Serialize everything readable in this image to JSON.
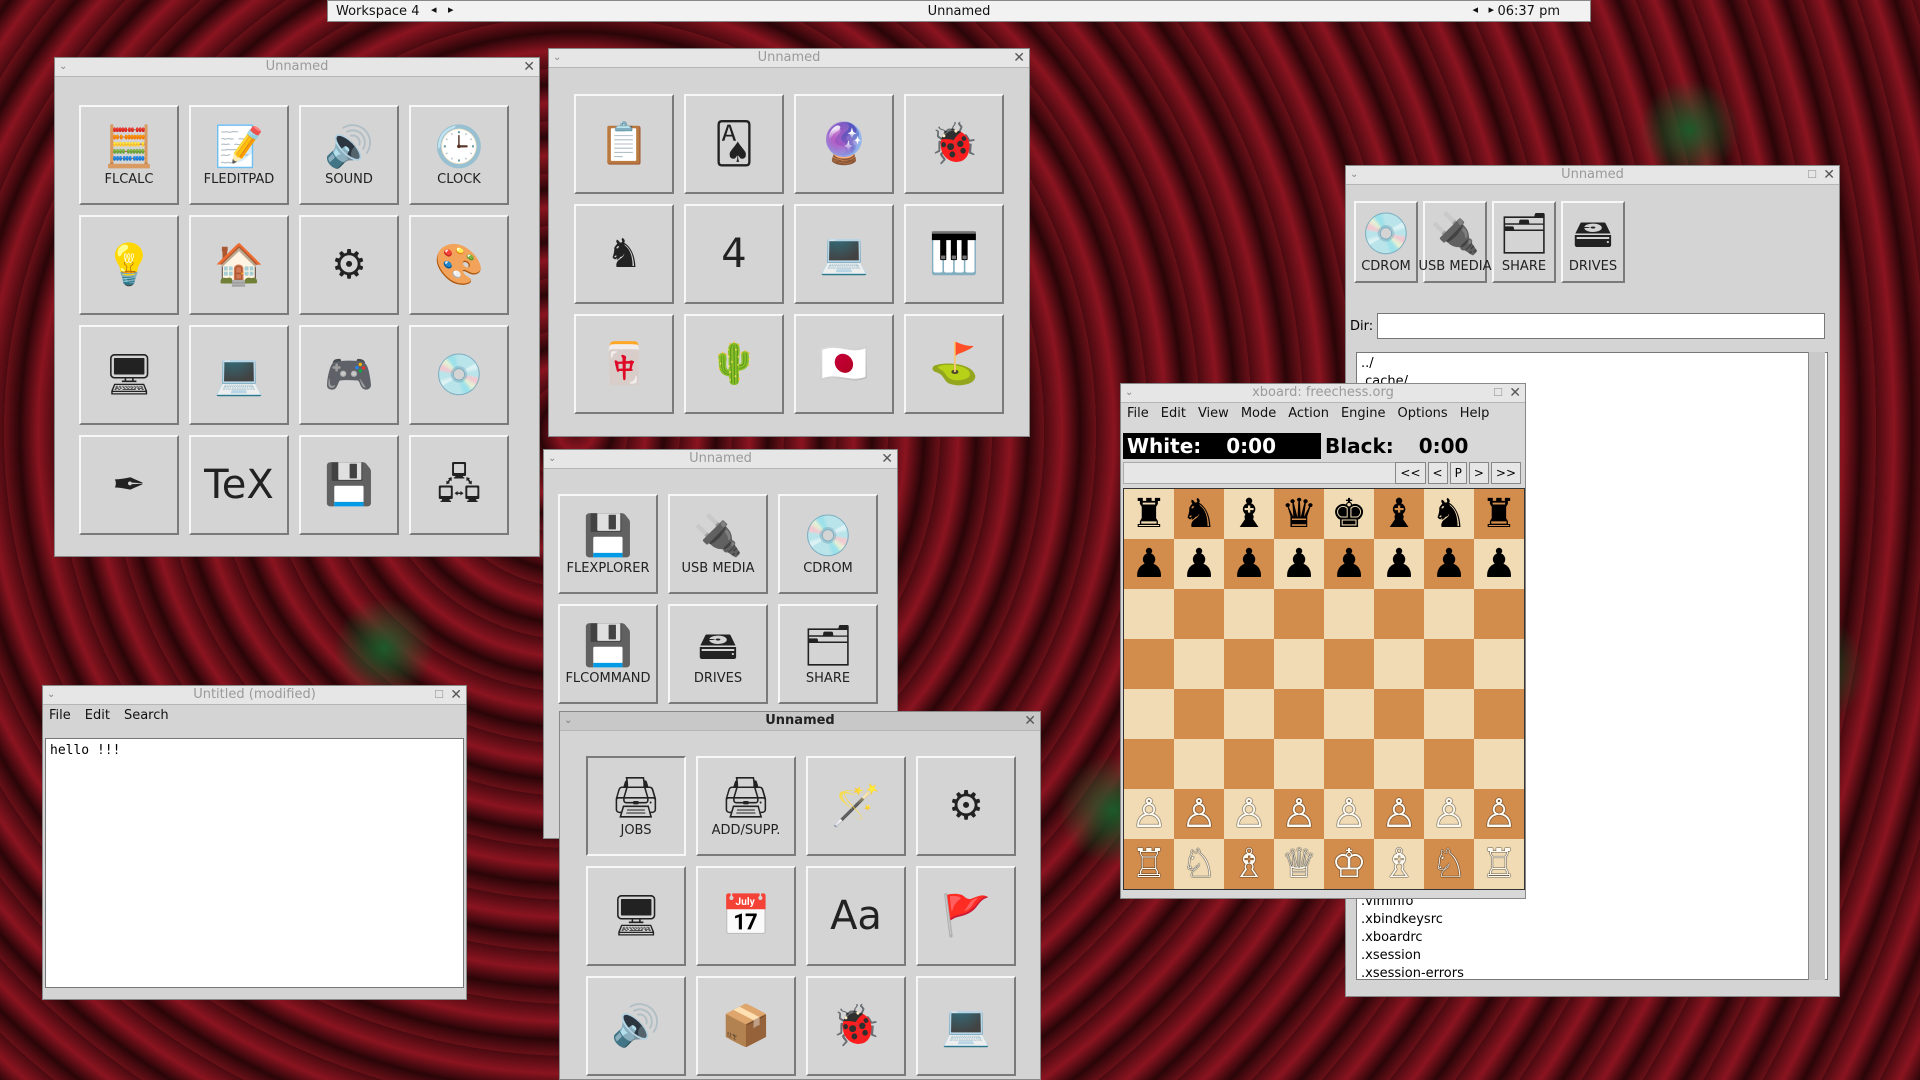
{
  "taskbar": {
    "workspace": "Workspace 4",
    "title": "Unnamed",
    "clock": "06:37 pm",
    "left_arrow": "◂",
    "right_arrow": "▸"
  },
  "win1": {
    "title": "Unnamed",
    "buttons": [
      {
        "icon": "calculator-icon",
        "glyph": "🧮",
        "label": "FLCALC"
      },
      {
        "icon": "notepad-icon",
        "glyph": "📝",
        "label": "FLEDITPAD"
      },
      {
        "icon": "speaker-icon",
        "glyph": "🔊",
        "label": "SOUND"
      },
      {
        "icon": "clock-icon",
        "glyph": "🕒",
        "label": "CLOCK"
      },
      {
        "icon": "lamp-icon",
        "glyph": "💡",
        "label": ""
      },
      {
        "icon": "home-icon",
        "glyph": "🏠",
        "label": ""
      },
      {
        "icon": "network-gear-icon",
        "glyph": "⚙",
        "label": ""
      },
      {
        "icon": "palette-icon",
        "glyph": "🎨",
        "label": ""
      },
      {
        "icon": "window-icon",
        "glyph": "🖥",
        "label": ""
      },
      {
        "icon": "terminal-icon",
        "glyph": "💻",
        "label": ""
      },
      {
        "icon": "gamepad-icon",
        "glyph": "🎮",
        "label": ""
      },
      {
        "icon": "music-disc-icon",
        "glyph": "💿",
        "label": ""
      },
      {
        "icon": "pen-icon",
        "glyph": "✒",
        "label": ""
      },
      {
        "icon": "tex-icon",
        "glyph": "TeX",
        "label": ""
      },
      {
        "icon": "floppy-icon",
        "glyph": "💾",
        "label": ""
      },
      {
        "icon": "remote-desktop-icon",
        "glyph": "🖧",
        "label": ""
      }
    ]
  },
  "win2": {
    "title": "Unnamed",
    "buttons": [
      {
        "icon": "chalkboard-icon",
        "glyph": "📋"
      },
      {
        "icon": "cards-icon",
        "glyph": "🂡"
      },
      {
        "icon": "ball-icon",
        "glyph": "🔮"
      },
      {
        "icon": "ladybug-icon",
        "glyph": "🐞"
      },
      {
        "icon": "chess-knight-icon",
        "glyph": "♞"
      },
      {
        "icon": "four-icon",
        "glyph": "4"
      },
      {
        "icon": "terminal-icon",
        "glyph": "💻"
      },
      {
        "icon": "piano-icon",
        "glyph": "🎹"
      },
      {
        "icon": "mahjong-icon",
        "glyph": "🀄"
      },
      {
        "icon": "cactus-icon",
        "glyph": "🌵"
      },
      {
        "icon": "japan-flag-icon",
        "glyph": "🇯🇵"
      },
      {
        "icon": "golf-flag-icon",
        "glyph": "⛳"
      }
    ]
  },
  "win3": {
    "title": "Unnamed",
    "buttons": [
      {
        "icon": "floppy-icon",
        "glyph": "💾",
        "label": "FLEXPLORER"
      },
      {
        "icon": "usb-icon",
        "glyph": "🔌",
        "label": "USB MEDIA"
      },
      {
        "icon": "cdrom-icon",
        "glyph": "💿",
        "label": "CDROM"
      },
      {
        "icon": "floppy-icon",
        "glyph": "💾",
        "label": "FLCOMMAND"
      },
      {
        "icon": "drive-icon",
        "glyph": "🖴",
        "label": "DRIVES"
      },
      {
        "icon": "share-icon",
        "glyph": "🗂",
        "label": "SHARE"
      }
    ]
  },
  "win4": {
    "title": "Unnamed",
    "buttons": [
      {
        "icon": "printer-icon",
        "glyph": "🖨",
        "label": "JOBS"
      },
      {
        "icon": "printer-icon",
        "glyph": "🖨",
        "label": "ADD/SUPP."
      },
      {
        "icon": "magic-wand-icon",
        "glyph": "🪄",
        "label": ""
      },
      {
        "icon": "network-gear-icon",
        "glyph": "⚙",
        "label": ""
      },
      {
        "icon": "display-icon",
        "glyph": "🖥",
        "label": ""
      },
      {
        "icon": "calendar-icon",
        "glyph": "📅",
        "label": ""
      },
      {
        "icon": "font-icon",
        "glyph": "Aa",
        "label": ""
      },
      {
        "icon": "flags-icon",
        "glyph": "🚩",
        "label": ""
      },
      {
        "icon": "speaker-icon",
        "glyph": "🔊",
        "label": ""
      },
      {
        "icon": "package-icon",
        "glyph": "📦",
        "label": ""
      },
      {
        "icon": "ladybug-icon",
        "glyph": "🐞",
        "label": ""
      },
      {
        "icon": "terminal-icon",
        "glyph": "💻",
        "label": ""
      }
    ]
  },
  "editor": {
    "title": "Untitled (modified)",
    "menu": [
      "File",
      "Edit",
      "Search"
    ],
    "content": "hello !!!"
  },
  "filemgr": {
    "title": "Unnamed",
    "buttons": [
      {
        "icon": "cdrom-icon",
        "glyph": "💿",
        "label": "CDROM"
      },
      {
        "icon": "usb-icon",
        "glyph": "🔌",
        "label": "USB MEDIA"
      },
      {
        "icon": "share-icon",
        "glyph": "🗂",
        "label": "SHARE"
      },
      {
        "icon": "drive-icon",
        "glyph": "🖴",
        "label": "DRIVES"
      }
    ],
    "dir_label": "Dir:",
    "dir_value": "",
    "files_top": [
      "../",
      ".cache/"
    ],
    "files_bottom": [
      ".viminfo",
      ".xbindkeysrc",
      ".xboardrc",
      ".xsession",
      ".xsession-errors"
    ]
  },
  "xboard": {
    "title": "xboard: freechess.org",
    "menu": [
      "File",
      "Edit",
      "View",
      "Mode",
      "Action",
      "Engine",
      "Options",
      "Help"
    ],
    "white": "White:",
    "white_time": "0:00",
    "black": "Black:",
    "black_time": "0:00",
    "nav": [
      "<<",
      "<",
      "P",
      ">",
      ">>"
    ],
    "board": [
      [
        "♜",
        "♞",
        "♝",
        "♛",
        "♚",
        "♝",
        "♞",
        "♜"
      ],
      [
        "♟",
        "♟",
        "♟",
        "♟",
        "♟",
        "♟",
        "♟",
        "♟"
      ],
      [
        "",
        "",
        "",
        "",
        "",
        "",
        "",
        ""
      ],
      [
        "",
        "",
        "",
        "",
        "",
        "",
        "",
        ""
      ],
      [
        "",
        "",
        "",
        "",
        "",
        "",
        "",
        ""
      ],
      [
        "",
        "",
        "",
        "",
        "",
        "",
        "",
        ""
      ],
      [
        "♙",
        "♙",
        "♙",
        "♙",
        "♙",
        "♙",
        "♙",
        "♙"
      ],
      [
        "♖",
        "♘",
        "♗",
        "♕",
        "♔",
        "♗",
        "♘",
        "♖"
      ]
    ]
  }
}
